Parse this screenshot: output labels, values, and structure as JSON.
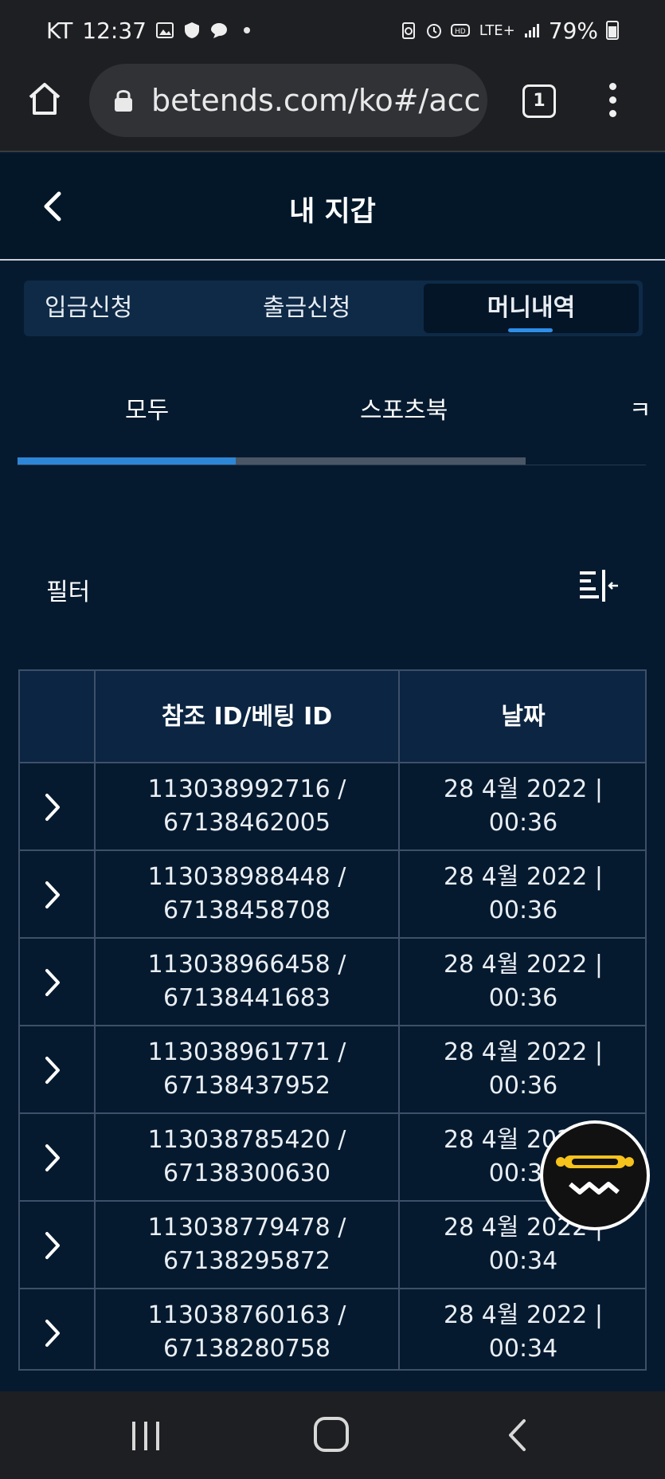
{
  "status_bar": {
    "carrier": "KT",
    "time": "12:37",
    "network": "LTE+",
    "battery": "79%"
  },
  "browser": {
    "url": "betends.com/ko#/acc",
    "tab_count": "1"
  },
  "header": {
    "title": "내 지갑"
  },
  "wallet_tabs": {
    "deposit": "입금신청",
    "withdraw": "출금신청",
    "history": "머니내역"
  },
  "sub_tabs": {
    "all": "모두",
    "sportsbook": "스포츠북",
    "third": "ㅋ",
    "progress": 0.43
  },
  "filter": {
    "label": "필터"
  },
  "table": {
    "headers": {
      "expand": "",
      "ref_id": "참조 ID/베팅 ID",
      "date": "날짜"
    },
    "rows": [
      {
        "ref": "113038992716 /",
        "bet": "67138462005",
        "date": "28 4월 2022 |",
        "time": "00:36"
      },
      {
        "ref": "113038988448 /",
        "bet": "67138458708",
        "date": "28 4월 2022 |",
        "time": "00:36"
      },
      {
        "ref": "113038966458 /",
        "bet": "67138441683",
        "date": "28 4월 2022 |",
        "time": "00:36"
      },
      {
        "ref": "113038961771 /",
        "bet": "67138437952",
        "date": "28 4월 2022 |",
        "time": "00:36"
      },
      {
        "ref": "113038785420 /",
        "bet": "67138300630",
        "date": "28 4월 2022 |",
        "time": "00:36"
      },
      {
        "ref": "113038779478 /",
        "bet": "67138295872",
        "date": "28 4월 2022 |",
        "time": "00:34"
      },
      {
        "ref": "113038760163 /",
        "bet": "67138280758",
        "date": "28 4월 2022 |",
        "time": "00:34"
      }
    ]
  },
  "colors": {
    "page_bg": "#061a2f",
    "accent": "#2e8ee8",
    "tab_bg": "#0e2a47",
    "table_head_bg": "#0b2542",
    "chrome_bg": "#1e1f22"
  }
}
